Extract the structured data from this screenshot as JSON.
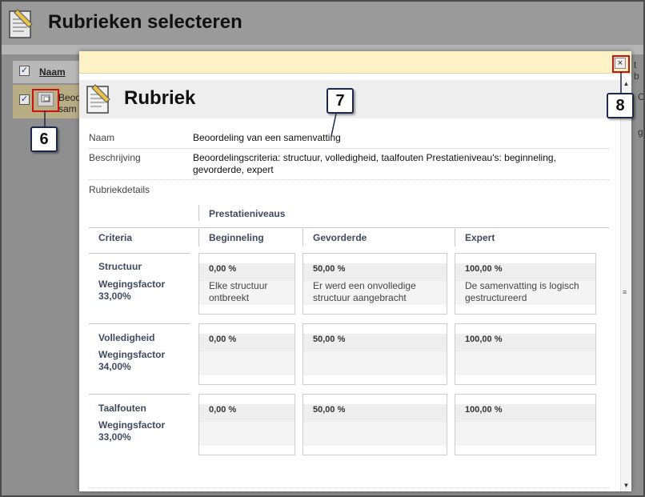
{
  "background": {
    "page_title": "Rubrieken selecteren",
    "column_name": "Naam",
    "row_text_1": "Beoord",
    "row_text_2": "sam",
    "right_fragment_1": "t b",
    "right_fragment_2": "C",
    "right_fragment_3": "g"
  },
  "modal": {
    "title": "Rubriek",
    "close_label": "×",
    "fields": {
      "naam_label": "Naam",
      "naam_value": "Beoordeling van een samenvatting",
      "beschrijving_label": "Beschrijving",
      "beschrijving_value": "Beoordelingscriteria: structuur, volledigheid, taalfouten Prestatieniveau's: beginneling, gevorderde, expert",
      "details_label": "Rubriekdetails"
    },
    "rubric": {
      "levels_header": "Prestatieniveaus",
      "criteria_header": "Criteria",
      "levels": [
        "Beginneling",
        "Gevorderde",
        "Expert"
      ],
      "criteria": [
        {
          "name": "Structuur",
          "weight_label": "Wegingsfactor",
          "weight_value": "33,00%",
          "cells": [
            {
              "pct": "0,00 %",
              "desc": "Elke structuur ontbreekt"
            },
            {
              "pct": "50,00 %",
              "desc": "Er werd een onvolledige structuur aangebracht"
            },
            {
              "pct": "100,00 %",
              "desc": "De samenvatting is logisch gestructureerd"
            }
          ]
        },
        {
          "name": "Volledigheid",
          "weight_label": "Wegingsfactor",
          "weight_value": "34,00%",
          "cells": [
            {
              "pct": "0,00 %",
              "desc": ""
            },
            {
              "pct": "50,00 %",
              "desc": ""
            },
            {
              "pct": "100,00 %",
              "desc": ""
            }
          ]
        },
        {
          "name": "Taalfouten",
          "weight_label": "Wegingsfactor",
          "weight_value": "33,00%",
          "cells": [
            {
              "pct": "0,00 %",
              "desc": ""
            },
            {
              "pct": "50,00 %",
              "desc": ""
            },
            {
              "pct": "100,00 %",
              "desc": ""
            }
          ]
        }
      ]
    }
  },
  "callouts": {
    "six": "6",
    "seven": "7",
    "eight": "8"
  },
  "icons": {
    "page": "document-pencil-icon",
    "close": "close-icon",
    "preview": "preview-icon"
  },
  "colors": {
    "modal_topbar": "#fdf2c5",
    "header_text": "#3d4a60",
    "callout_border": "#cc1111"
  }
}
